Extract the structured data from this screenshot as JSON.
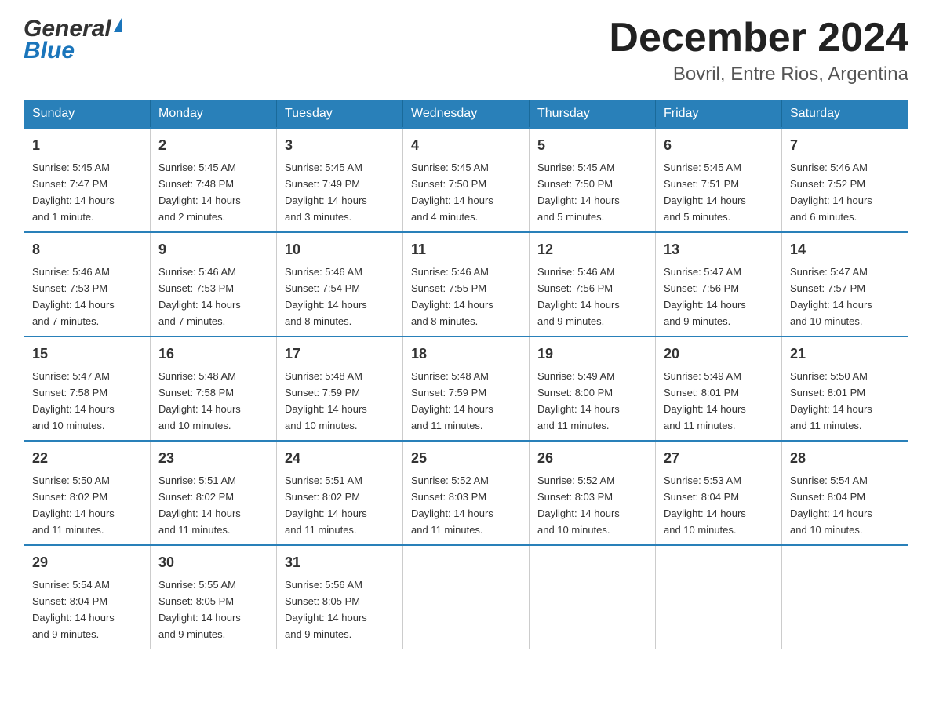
{
  "logo": {
    "general": "General",
    "blue": "Blue"
  },
  "header": {
    "title": "December 2024",
    "subtitle": "Bovril, Entre Rios, Argentina"
  },
  "days_of_week": [
    "Sunday",
    "Monday",
    "Tuesday",
    "Wednesday",
    "Thursday",
    "Friday",
    "Saturday"
  ],
  "weeks": [
    [
      {
        "num": "1",
        "sunrise": "5:45 AM",
        "sunset": "7:47 PM",
        "daylight": "14 hours and 1 minute."
      },
      {
        "num": "2",
        "sunrise": "5:45 AM",
        "sunset": "7:48 PM",
        "daylight": "14 hours and 2 minutes."
      },
      {
        "num": "3",
        "sunrise": "5:45 AM",
        "sunset": "7:49 PM",
        "daylight": "14 hours and 3 minutes."
      },
      {
        "num": "4",
        "sunrise": "5:45 AM",
        "sunset": "7:50 PM",
        "daylight": "14 hours and 4 minutes."
      },
      {
        "num": "5",
        "sunrise": "5:45 AM",
        "sunset": "7:50 PM",
        "daylight": "14 hours and 5 minutes."
      },
      {
        "num": "6",
        "sunrise": "5:45 AM",
        "sunset": "7:51 PM",
        "daylight": "14 hours and 5 minutes."
      },
      {
        "num": "7",
        "sunrise": "5:46 AM",
        "sunset": "7:52 PM",
        "daylight": "14 hours and 6 minutes."
      }
    ],
    [
      {
        "num": "8",
        "sunrise": "5:46 AM",
        "sunset": "7:53 PM",
        "daylight": "14 hours and 7 minutes."
      },
      {
        "num": "9",
        "sunrise": "5:46 AM",
        "sunset": "7:53 PM",
        "daylight": "14 hours and 7 minutes."
      },
      {
        "num": "10",
        "sunrise": "5:46 AM",
        "sunset": "7:54 PM",
        "daylight": "14 hours and 8 minutes."
      },
      {
        "num": "11",
        "sunrise": "5:46 AM",
        "sunset": "7:55 PM",
        "daylight": "14 hours and 8 minutes."
      },
      {
        "num": "12",
        "sunrise": "5:46 AM",
        "sunset": "7:56 PM",
        "daylight": "14 hours and 9 minutes."
      },
      {
        "num": "13",
        "sunrise": "5:47 AM",
        "sunset": "7:56 PM",
        "daylight": "14 hours and 9 minutes."
      },
      {
        "num": "14",
        "sunrise": "5:47 AM",
        "sunset": "7:57 PM",
        "daylight": "14 hours and 10 minutes."
      }
    ],
    [
      {
        "num": "15",
        "sunrise": "5:47 AM",
        "sunset": "7:58 PM",
        "daylight": "14 hours and 10 minutes."
      },
      {
        "num": "16",
        "sunrise": "5:48 AM",
        "sunset": "7:58 PM",
        "daylight": "14 hours and 10 minutes."
      },
      {
        "num": "17",
        "sunrise": "5:48 AM",
        "sunset": "7:59 PM",
        "daylight": "14 hours and 10 minutes."
      },
      {
        "num": "18",
        "sunrise": "5:48 AM",
        "sunset": "7:59 PM",
        "daylight": "14 hours and 11 minutes."
      },
      {
        "num": "19",
        "sunrise": "5:49 AM",
        "sunset": "8:00 PM",
        "daylight": "14 hours and 11 minutes."
      },
      {
        "num": "20",
        "sunrise": "5:49 AM",
        "sunset": "8:01 PM",
        "daylight": "14 hours and 11 minutes."
      },
      {
        "num": "21",
        "sunrise": "5:50 AM",
        "sunset": "8:01 PM",
        "daylight": "14 hours and 11 minutes."
      }
    ],
    [
      {
        "num": "22",
        "sunrise": "5:50 AM",
        "sunset": "8:02 PM",
        "daylight": "14 hours and 11 minutes."
      },
      {
        "num": "23",
        "sunrise": "5:51 AM",
        "sunset": "8:02 PM",
        "daylight": "14 hours and 11 minutes."
      },
      {
        "num": "24",
        "sunrise": "5:51 AM",
        "sunset": "8:02 PM",
        "daylight": "14 hours and 11 minutes."
      },
      {
        "num": "25",
        "sunrise": "5:52 AM",
        "sunset": "8:03 PM",
        "daylight": "14 hours and 11 minutes."
      },
      {
        "num": "26",
        "sunrise": "5:52 AM",
        "sunset": "8:03 PM",
        "daylight": "14 hours and 10 minutes."
      },
      {
        "num": "27",
        "sunrise": "5:53 AM",
        "sunset": "8:04 PM",
        "daylight": "14 hours and 10 minutes."
      },
      {
        "num": "28",
        "sunrise": "5:54 AM",
        "sunset": "8:04 PM",
        "daylight": "14 hours and 10 minutes."
      }
    ],
    [
      {
        "num": "29",
        "sunrise": "5:54 AM",
        "sunset": "8:04 PM",
        "daylight": "14 hours and 9 minutes."
      },
      {
        "num": "30",
        "sunrise": "5:55 AM",
        "sunset": "8:05 PM",
        "daylight": "14 hours and 9 minutes."
      },
      {
        "num": "31",
        "sunrise": "5:56 AM",
        "sunset": "8:05 PM",
        "daylight": "14 hours and 9 minutes."
      },
      null,
      null,
      null,
      null
    ]
  ],
  "labels": {
    "sunrise": "Sunrise:",
    "sunset": "Sunset:",
    "daylight": "Daylight:"
  }
}
